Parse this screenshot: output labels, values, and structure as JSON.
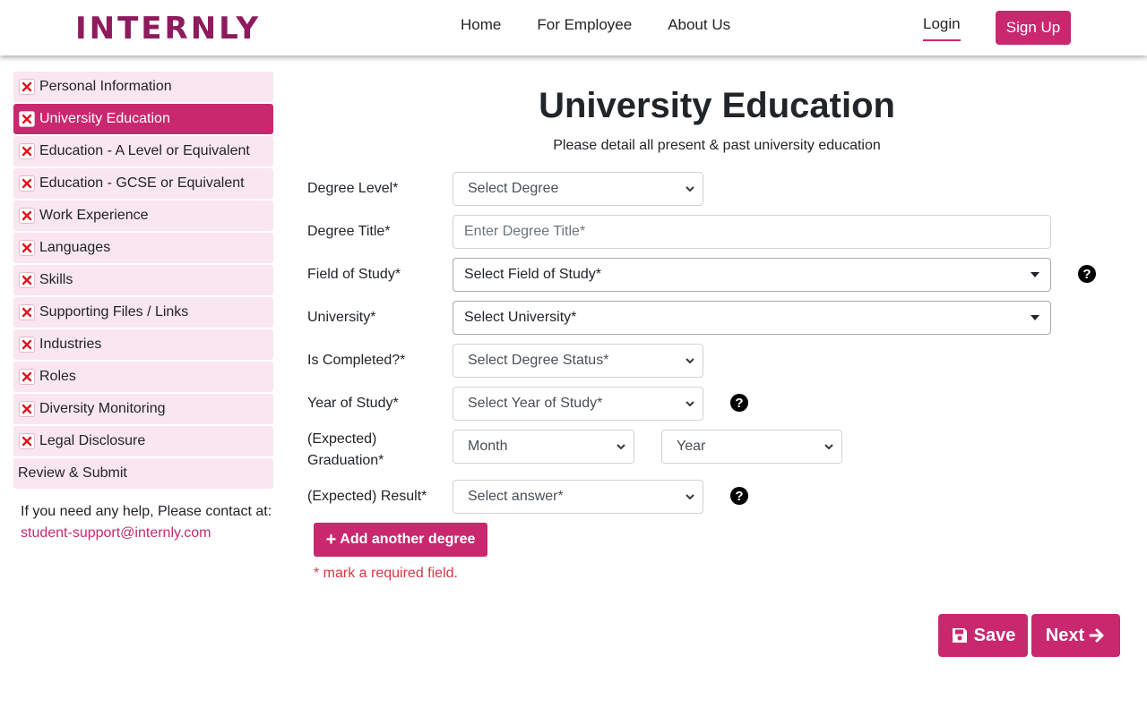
{
  "header": {
    "logo": "INTERNLY",
    "nav": [
      "Home",
      "For Employee",
      "About Us"
    ],
    "login": "Login",
    "signup": "Sign Up"
  },
  "sidebar": {
    "items": [
      {
        "label": "Personal Information",
        "status": "incomplete"
      },
      {
        "label": "University Education",
        "status": "incomplete",
        "active": true
      },
      {
        "label": "Education - A Level or Equivalent",
        "status": "incomplete"
      },
      {
        "label": "Education - GCSE or Equivalent",
        "status": "incomplete"
      },
      {
        "label": "Work Experience",
        "status": "incomplete"
      },
      {
        "label": "Languages",
        "status": "incomplete"
      },
      {
        "label": "Skills",
        "status": "incomplete"
      },
      {
        "label": "Supporting Files / Links",
        "status": "incomplete"
      },
      {
        "label": "Industries",
        "status": "incomplete"
      },
      {
        "label": "Roles",
        "status": "incomplete"
      },
      {
        "label": "Diversity Monitoring",
        "status": "incomplete"
      },
      {
        "label": "Legal Disclosure",
        "status": "incomplete"
      }
    ],
    "review": "Review & Submit",
    "help_text": "If you need any help, Please contact at:",
    "help_email": "student-support@internly.com"
  },
  "main": {
    "title": "University Education",
    "subtitle": "Please detail all present & past university education",
    "fields": {
      "degree_level": {
        "label": "Degree Level*",
        "value": "Select Degree"
      },
      "degree_title": {
        "label": "Degree Title*",
        "placeholder": "Enter Degree Title*"
      },
      "field_of_study": {
        "label": "Field of Study*",
        "value": "Select Field of Study*"
      },
      "university": {
        "label": "University*",
        "value": "Select University*"
      },
      "is_completed": {
        "label": "Is Completed?*",
        "value": "Select Degree Status*"
      },
      "year_of_study": {
        "label": "Year of Study*",
        "value": "Select Year of Study*"
      },
      "graduation": {
        "label_line1": "(Expected)",
        "label_line2": "Graduation*",
        "month": "Month",
        "year": "Year"
      },
      "result": {
        "label": "(Expected) Result*",
        "value": "Select answer*"
      }
    },
    "add_button": "Add another degree",
    "required_note": "* mark a required field.",
    "save": "Save",
    "next": "Next"
  },
  "colors": {
    "brand": "#c9286f",
    "logo": "#8e1b5e",
    "sidebar_bg": "#f9e6ee",
    "error": "#dc3545"
  }
}
